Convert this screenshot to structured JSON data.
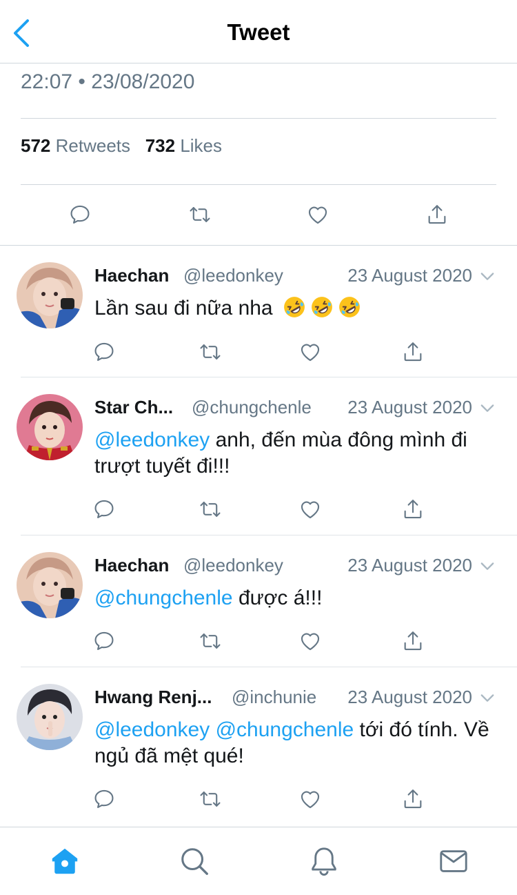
{
  "header": {
    "title": "Tweet",
    "back_icon": "chevron-left-icon"
  },
  "tweet": {
    "time": "22:07",
    "separator": "•",
    "date": "23/08/2020",
    "retweets_count": "572",
    "retweets_label": "Retweets",
    "likes_count": "732",
    "likes_label": "Likes"
  },
  "replies": [
    {
      "name": "Haechan",
      "handle": "@leedonkey",
      "date": "23 August 2020",
      "mentions": [],
      "text": "Lần sau đi nữa nha",
      "emojis": [
        "rofl-emoji",
        "rofl-emoji",
        "rofl-emoji"
      ]
    },
    {
      "name": "Star Ch...",
      "handle": "@chungchenle",
      "date": "23 August 2020",
      "mentions": [
        "@leedonkey"
      ],
      "text": "anh, đến mùa đông mình đi trượt tuyết đi!!!"
    },
    {
      "name": "Haechan",
      "handle": "@leedonkey",
      "date": "23 August 2020",
      "mentions": [
        "@chungchenle"
      ],
      "text": "được á!!!"
    },
    {
      "name": "Hwang Renj...",
      "handle": "@inchunie",
      "date": "23 August 2020",
      "mentions": [
        "@leedonkey",
        "@chungchenle"
      ],
      "text": "tới đó tính. Về ngủ đã mệt qué!"
    }
  ],
  "colors": {
    "accent": "#1da1f2",
    "secondary_text": "#657786",
    "icon": "#657786",
    "divider": "#cfd6dc"
  },
  "tabs": [
    {
      "name": "home",
      "icon": "home-icon",
      "active": true
    },
    {
      "name": "search",
      "icon": "search-icon",
      "active": false
    },
    {
      "name": "notifications",
      "icon": "bell-icon",
      "active": false
    },
    {
      "name": "messages",
      "icon": "mail-icon",
      "active": false
    }
  ]
}
